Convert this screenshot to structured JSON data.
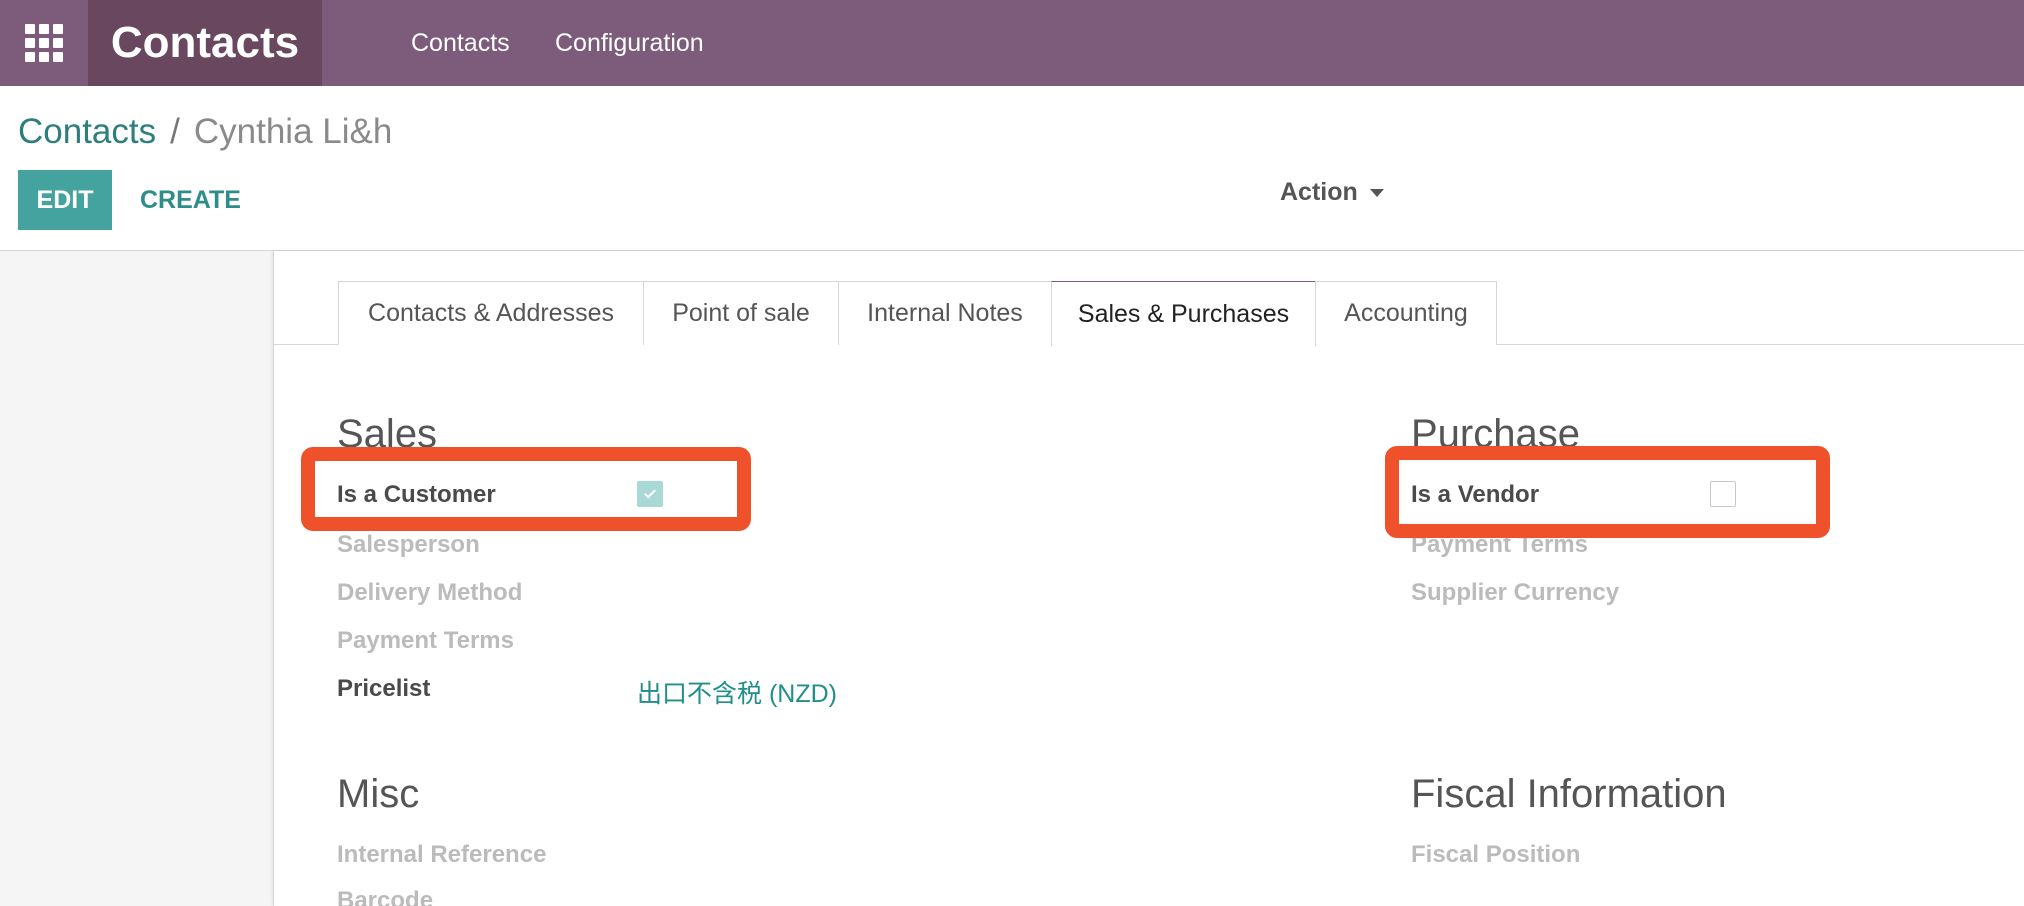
{
  "navbar": {
    "apps_icon": "grid-icon",
    "brand": "Contacts",
    "links": [
      "Contacts",
      "Configuration"
    ]
  },
  "breadcrumb": {
    "parent": "Contacts",
    "separator": "/",
    "current": "Cynthia Li&h"
  },
  "buttons": {
    "edit": "EDIT",
    "create": "CREATE",
    "action": "Action"
  },
  "tabs": [
    {
      "label": "Contacts & Addresses",
      "active": false
    },
    {
      "label": "Point of sale",
      "active": false
    },
    {
      "label": "Internal Notes",
      "active": false
    },
    {
      "label": "Sales & Purchases",
      "active": true
    },
    {
      "label": "Accounting",
      "active": false
    }
  ],
  "sales": {
    "title": "Sales",
    "is_customer_label": "Is a Customer",
    "is_customer": true,
    "salesperson_label": "Salesperson",
    "delivery_method_label": "Delivery Method",
    "payment_terms_label": "Payment Terms",
    "pricelist_label": "Pricelist",
    "pricelist_value": "出口不含税 (NZD)"
  },
  "purchase": {
    "title": "Purchase",
    "is_vendor_label": "Is a Vendor",
    "is_vendor": false,
    "payment_terms_label": "Payment Terms",
    "supplier_currency_label": "Supplier Currency"
  },
  "misc": {
    "title": "Misc",
    "internal_reference_label": "Internal Reference",
    "barcode_label": "Barcode"
  },
  "fiscal": {
    "title": "Fiscal Information",
    "fiscal_position_label": "Fiscal Position"
  },
  "colors": {
    "navbar": "#7c5b7b",
    "brand_bg": "#68475f",
    "primary": "#44a39e",
    "link": "#2d7f7b",
    "highlight": "#ef522a"
  }
}
